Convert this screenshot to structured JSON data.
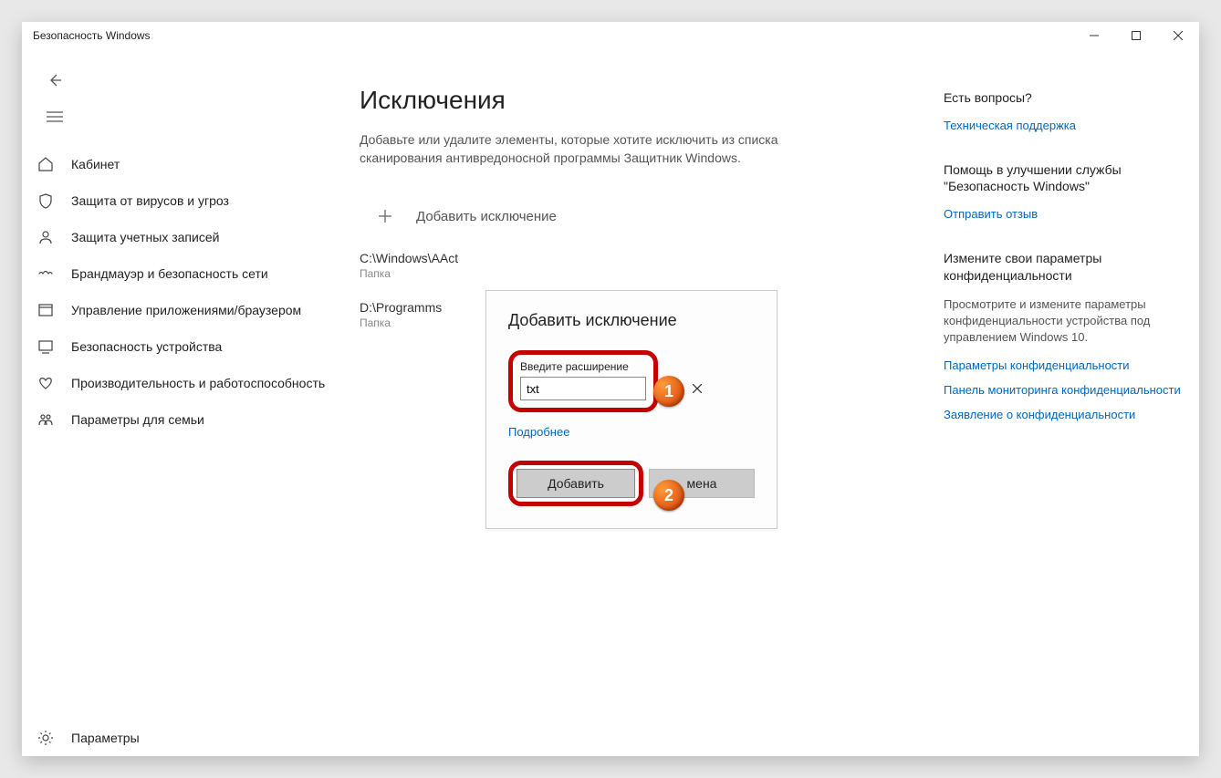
{
  "titlebar": {
    "title": "Безопасность Windows"
  },
  "sidebar": {
    "items": [
      {
        "label": "Кабинет"
      },
      {
        "label": "Защита от вирусов и угроз"
      },
      {
        "label": "Защита учетных записей"
      },
      {
        "label": "Брандмауэр и безопасность сети"
      },
      {
        "label": "Управление приложениями/браузером"
      },
      {
        "label": "Безопасность устройства"
      },
      {
        "label": "Производительность и работоспособность"
      },
      {
        "label": "Параметры для семьи"
      }
    ],
    "settings_label": "Параметры"
  },
  "main": {
    "heading": "Исключения",
    "description": "Добавьте или удалите элементы, которые хотите исключить из списка сканирования антивредоносной программы Защитник Windows.",
    "add_label": "Добавить исключение",
    "exclusions": [
      {
        "path": "C:\\Windows\\AAct",
        "type": "Папка"
      },
      {
        "path": "D:\\Programms",
        "type": "Папка"
      }
    ]
  },
  "dialog": {
    "title": "Добавить исключение",
    "input_label": "Введите расширение",
    "input_value": "txt",
    "more_link": "Подробнее",
    "add_btn": "Добавить",
    "cancel_btn": "мена"
  },
  "aside": {
    "q_title": "Есть вопросы?",
    "q_link": "Техническая поддержка",
    "help_title": "Помощь в улучшении службы \"Безопасность Windows\"",
    "help_link": "Отправить отзыв",
    "priv_title": "Измените свои параметры конфиденциальности",
    "priv_text": "Просмотрите и измените параметры конфиденциальности устройства под управлением Windows 10.",
    "priv_link1": "Параметры конфиденциальности",
    "priv_link2": "Панель мониторинга конфиденциальности",
    "priv_link3": "Заявление о конфиденциальности"
  },
  "badges": {
    "b1": "1",
    "b2": "2"
  }
}
